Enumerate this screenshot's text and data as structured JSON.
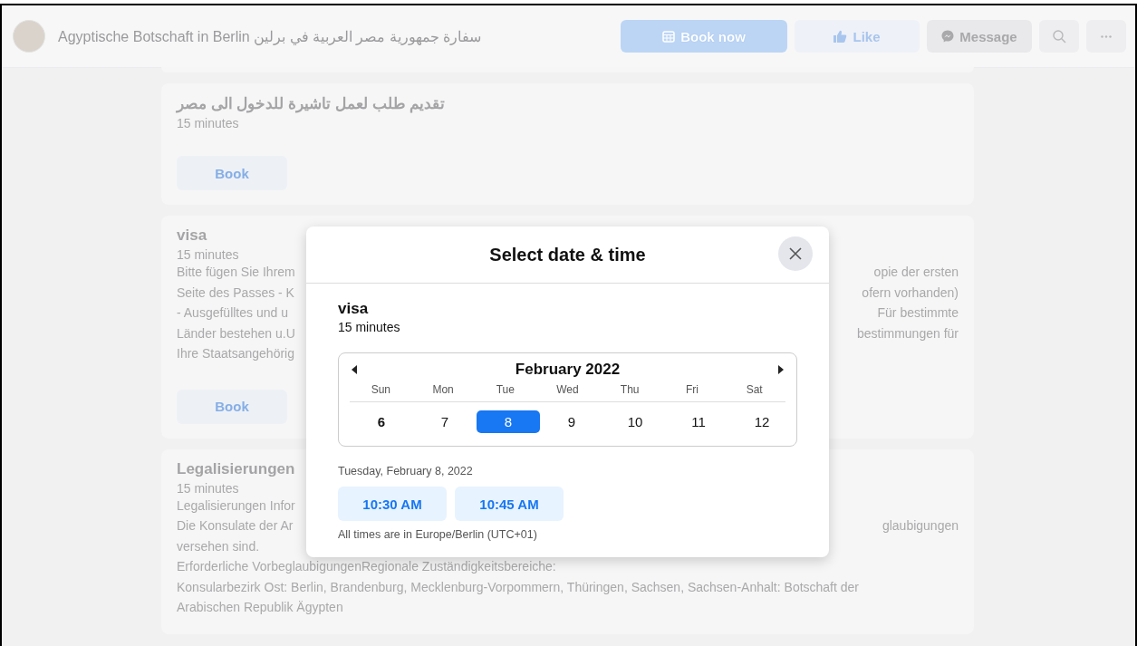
{
  "header": {
    "page_name": "Agyptische Botschaft in Berlin سفارة جمهورية مصر العربية في برلين",
    "buttons": [
      {
        "label": "Book now",
        "kind": "primary"
      },
      {
        "label": "Like",
        "kind": "like"
      },
      {
        "label": "Message",
        "kind": "message"
      }
    ]
  },
  "services": [
    {
      "title": "تقديم طلب لعمل تاشيرة للدخول الى مصر",
      "duration": "15 minutes",
      "book": "Book"
    },
    {
      "title": "visa",
      "duration": "15 minutes",
      "lines": [
        {
          "left": "Bitte fügen Sie Ihrem",
          "right": "opie der ersten"
        },
        {
          "left": "Seite des Passes - K",
          "right": "ofern vorhanden)"
        },
        {
          "left": "- Ausgefülltes und u",
          "right": "Für bestimmte"
        },
        {
          "left": "Länder bestehen u.U",
          "right": "bestimmungen für"
        },
        {
          "left": "Ihre Staatsangehörig"
        }
      ],
      "book": "Book"
    },
    {
      "title": "Legalisierungen",
      "duration": "15 minutes",
      "lines": [
        {
          "left": "Legalisierungen Infor"
        },
        {
          "left": "Die Konsulate der Ar",
          "right": "glaubigungen"
        },
        {
          "left": "versehen sind."
        },
        {
          "left": "Erforderliche VorbeglaubigungenRegionale Zuständigkeitsbereiche:"
        },
        {
          "left": "Konsularbezirk Ost: Berlin, Brandenburg, Mecklenburg-Vorpommern, Thüringen, Sachsen, Sachsen-Anhalt: Botschaft der"
        },
        {
          "left": "Arabischen Republik Ägypten"
        }
      ]
    }
  ],
  "modal": {
    "title": "Select date & time",
    "service": "visa",
    "duration": "15 minutes",
    "calendar": {
      "month": "February 2022",
      "weekdays": [
        "Sun",
        "Mon",
        "Tue",
        "Wed",
        "Thu",
        "Fri",
        "Sat"
      ],
      "days": [
        {
          "label": "6",
          "selected": false,
          "today": true
        },
        {
          "label": "7",
          "selected": false,
          "today": false
        },
        {
          "label": "8",
          "selected": true,
          "today": false
        },
        {
          "label": "9",
          "selected": false,
          "today": false
        },
        {
          "label": "10",
          "selected": false,
          "today": false
        },
        {
          "label": "11",
          "selected": false,
          "today": false
        },
        {
          "label": "12",
          "selected": false,
          "today": false
        }
      ]
    },
    "selected_date": "Tuesday, February 8, 2022",
    "times": [
      "10:30 AM",
      "10:45 AM"
    ],
    "timezone_note": "All times are in Europe/Berlin (UTC+01)"
  }
}
